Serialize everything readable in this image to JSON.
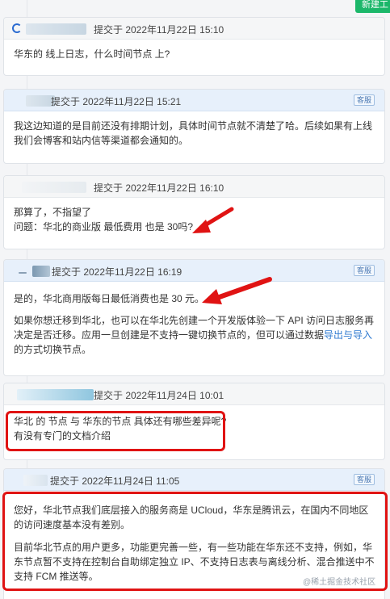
{
  "header": {
    "new_button": "新建工"
  },
  "messages": [
    {
      "meta": "提交于 2022年11月22日 15:10",
      "lines": [
        "华东的 线上日志，什么时间节点 上?"
      ]
    },
    {
      "meta": "提交于 2022年11月22日 15:21",
      "tag": "客服",
      "lines": [
        "我这边知道的是目前还没有排期计划，具体时间节点就不清楚了哈。后续如果有上线我们会博客和站内信等渠道都会通知的。"
      ]
    },
    {
      "meta": "提交于 2022年11月22日 16:10",
      "lines": [
        "那算了，不指望了",
        "问题：华北的商业版 最低费用 也是 30吗?"
      ]
    },
    {
      "meta": "提交于 2022年11月22日 16:19",
      "tag": "客服",
      "p1": "是的，华北商用版每日最低消费也是 30 元。",
      "p2_before": "如果你想迁移到华北，也可以在华北先创建一个开发版体验一下 API 访问日志服务再决定是否迁移。应用一旦创建是不支持一键切换节点的，但可以通过数据",
      "p2_link": "导出与导入",
      "p2_after": "的方式切换节点。"
    },
    {
      "meta": "提交于 2022年11月24日 10:01",
      "lines": [
        "华北 的 节点 与 华东的节点 具体还有哪些差异呢?",
        "有没有专门的文档介绍"
      ]
    },
    {
      "meta": "提交于 2022年11月24日 11:05",
      "tag": "客服",
      "p1": "您好，华北节点我们底层接入的服务商是 UCloud，华东是腾讯云，在国内不同地区的访问速度基本没有差别。",
      "p2": "目前华北节点的用户更多，功能更完善一些，有一些功能在华东还不支持，例如，华东节点暂不支持在控制台自助绑定独立 IP、不支持日志表与离线分析、混合推送中不支持 FCM 推送等。"
    }
  ],
  "watermark": "@稀土掘金技术社区",
  "colors": {
    "annotation": "#e01313",
    "accent": "#1cb76a",
    "link": "#2f7ad0"
  }
}
